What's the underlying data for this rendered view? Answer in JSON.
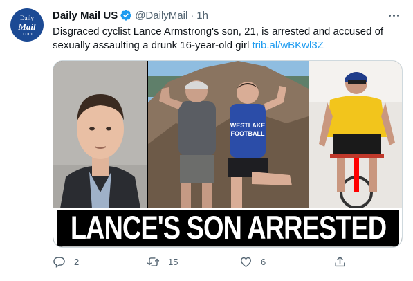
{
  "avatar": {
    "line1": "Daily",
    "line2": "Mail",
    "line3": ".com"
  },
  "author": {
    "display_name": "Daily Mail US",
    "handle": "@DailyMail",
    "separator": "·",
    "time": "1h"
  },
  "tweet": {
    "text": "Disgraced cyclist Lance Armstrong's son, 21, is arrested and accused of sexually assaulting a drunk 16-year-old girl",
    "link": "trib.al/wBKwl3Z"
  },
  "media": {
    "headline": "LANCE'S SON ARRESTED",
    "jersey_text_line1": "WESTLAKE",
    "jersey_text_line2": "FOOTBALL"
  },
  "actions": {
    "reply_count": "2",
    "retweet_count": "15",
    "like_count": "6"
  },
  "colors": {
    "link": "#1d9bf0",
    "verified": "#1d9bf0",
    "secondary_text": "#536471",
    "avatar_bg": "#1c4a94"
  }
}
